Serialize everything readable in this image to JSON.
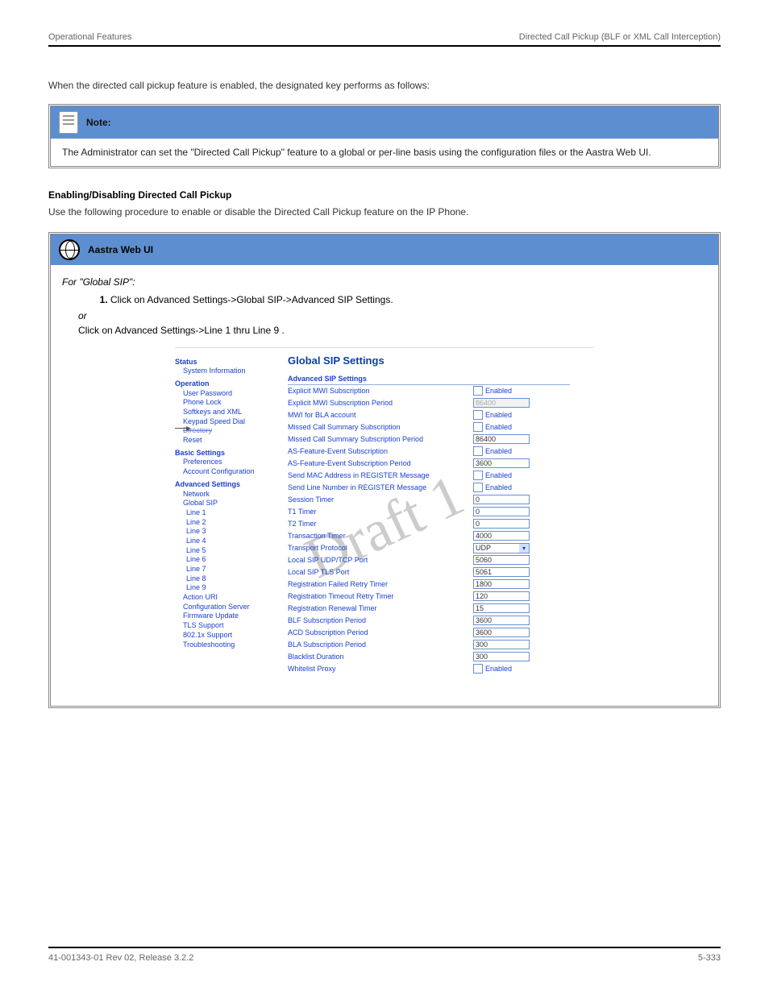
{
  "header": {
    "left": "Operational Features",
    "right": "Directed Call Pickup (BLF or XML Call Interception)"
  },
  "intro": "When the directed call pickup feature is enabled, the designated key performs as follows:",
  "note": {
    "title": "Note:",
    "body": "The Administrator can set the \"Directed Call Pickup\" feature to a global or per-line basis using the configuration files or the Aastra Web UI."
  },
  "instructions": {
    "title": "Enabling/Disabling Directed Call Pickup",
    "intro": "Use the following procedure to enable or disable the Directed Call Pickup feature on the IP Phone.",
    "steps": [
      "Click on Advanced Settings->Global SIP->Advanced SIP Settings.",
      "or",
      "Click on Advanced Settings->Line 1 thru Line 9 ."
    ]
  },
  "wui": {
    "title": "Aastra Web UI",
    "body": "For \"Global SIP\":"
  },
  "watermark": "Draft 1",
  "sidebar": {
    "status": "Status",
    "status_items": [
      "System Information"
    ],
    "operation": "Operation",
    "operation_items": [
      "User Password",
      "Phone Lock",
      "Softkeys and XML",
      "Keypad Speed Dial",
      "Directory",
      "Reset"
    ],
    "basic": "Basic Settings",
    "basic_items": [
      "Preferences",
      "Account Configuration"
    ],
    "advanced": "Advanced Settings",
    "advanced_items": [
      "Network",
      "Global SIP",
      "Line 1",
      "Line 2",
      "Line 3",
      "Line 4",
      "Line 5",
      "Line 6",
      "Line 7",
      "Line 8",
      "Line 9",
      "Action URI",
      "Configuration Server",
      "Firmware Update",
      "TLS Support",
      "802.1x Support",
      "Troubleshooting"
    ]
  },
  "content": {
    "title": "Global SIP Settings",
    "section": "Advanced SIP Settings",
    "enabled_label": "Enabled",
    "rows": [
      {
        "label": "Explicit MWI Subscription",
        "type": "check"
      },
      {
        "label": "Explicit MWI Subscription Period",
        "type": "text",
        "disabled": true,
        "value": "86400"
      },
      {
        "label": "MWI for BLA account",
        "type": "check"
      },
      {
        "label": "Missed Call Summary Subscription",
        "type": "check"
      },
      {
        "label": "Missed Call Summary Subscription Period",
        "type": "text",
        "value": "86400"
      },
      {
        "label": "AS-Feature-Event Subscription",
        "type": "check"
      },
      {
        "label": "AS-Feature-Event Subscription Period",
        "type": "text",
        "value": "3600"
      },
      {
        "label": "Send MAC Address in REGISTER Message",
        "type": "check"
      },
      {
        "label": "Send Line Number in REGISTER Message",
        "type": "check"
      },
      {
        "label": "Session Timer",
        "type": "text",
        "value": "0"
      },
      {
        "label": "T1 Timer",
        "type": "text",
        "value": "0"
      },
      {
        "label": "T2 Timer",
        "type": "text",
        "value": "0"
      },
      {
        "label": "Transaction Timer",
        "type": "text",
        "value": "4000"
      },
      {
        "label": "Transport Protocol",
        "type": "select",
        "value": "UDP"
      },
      {
        "label": "Local SIP UDP/TCP Port",
        "type": "text",
        "value": "5060"
      },
      {
        "label": "Local SIP TLS Port",
        "type": "text",
        "value": "5061"
      },
      {
        "label": "Registration Failed Retry Timer",
        "type": "text",
        "value": "1800"
      },
      {
        "label": "Registration Timeout Retry Timer",
        "type": "text",
        "value": "120"
      },
      {
        "label": "Registration Renewal Timer",
        "type": "text",
        "value": "15"
      },
      {
        "label": "BLF Subscription Period",
        "type": "text",
        "value": "3600"
      },
      {
        "label": "ACD Subscription Period",
        "type": "text",
        "value": "3600"
      },
      {
        "label": "BLA Subscription Period",
        "type": "text",
        "value": "300"
      },
      {
        "label": "Blacklist Duration",
        "type": "text",
        "value": "300"
      },
      {
        "label": "Whitelist Proxy",
        "type": "check"
      }
    ]
  },
  "footer": {
    "left": "41-001343-01 Rev 02, Release 3.2.2",
    "right": "5-333"
  }
}
